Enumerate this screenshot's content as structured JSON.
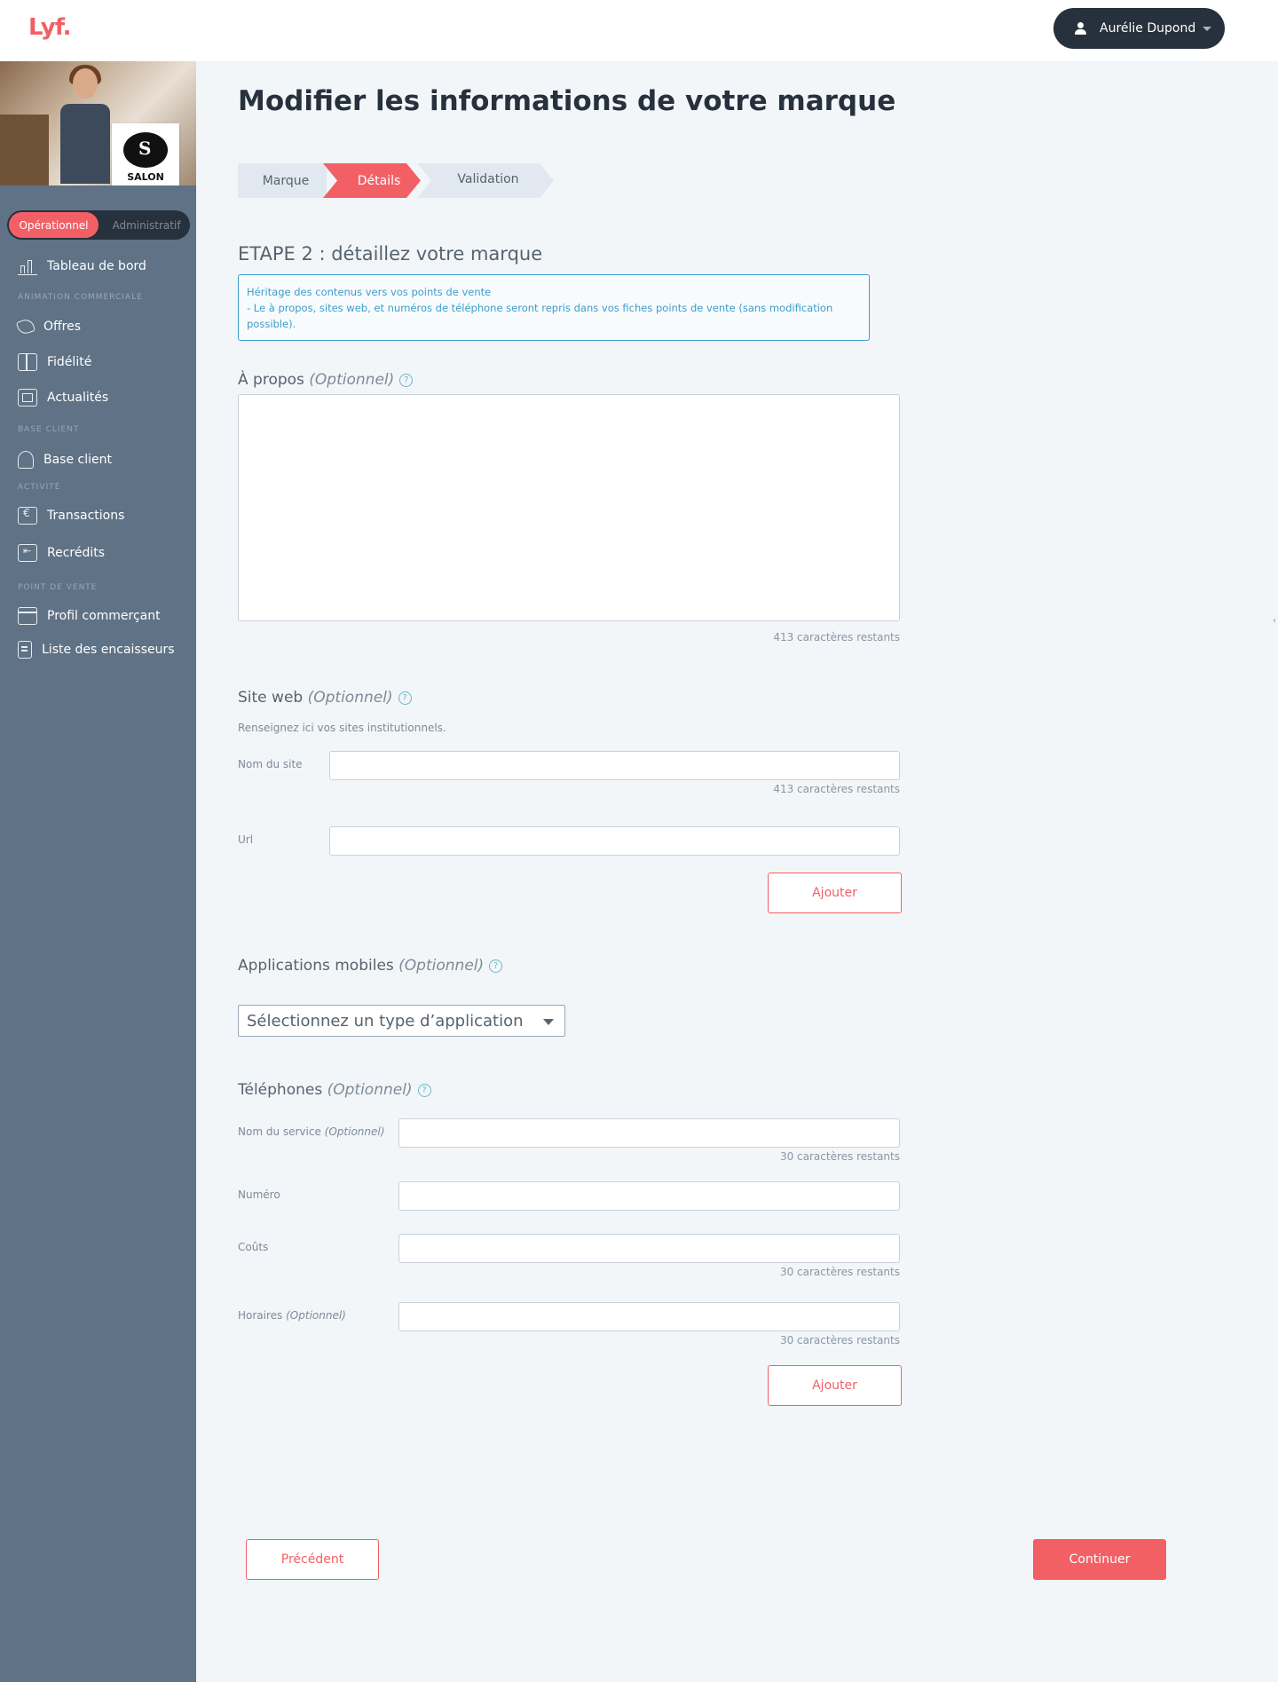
{
  "app": {
    "logo": "Lyf.",
    "user_name": "Aurélie Dupond"
  },
  "sidebar": {
    "brand_logo_text": "SALON",
    "toggle": {
      "active": "Opérationnel",
      "inactive": "Administratif"
    },
    "sections": {
      "animation": "ANIMATION COMMERCIALE",
      "base": "BASE CLIENT",
      "activite": "ACTIVITÉ",
      "point_vente": "POINT DE VENTE"
    },
    "items": {
      "tableau": "Tableau de bord",
      "offres": "Offres",
      "fidelite": "Fidélité",
      "actualites": "Actualités",
      "base_client": "Base client",
      "transactions": "Transactions",
      "recredits": "Recrédits",
      "profil": "Profil commerçant",
      "encaisseurs": "Liste des encaisseurs"
    }
  },
  "page": {
    "title": "Modifier les informations de votre marque",
    "steps": [
      "Marque",
      "Détails",
      "Validation"
    ],
    "step_heading": "ETAPE 2 : détaillez votre marque",
    "info_line1": "Héritage des contenus vers vos points de vente",
    "info_line2": "- Le à propos, sites web, et numéros de téléphone seront repris dans vos fiches points de vente (sans modification possible)."
  },
  "about": {
    "label": "À propos",
    "optional": "(Optionnel)",
    "counter": "413 caractères restants"
  },
  "website": {
    "label": "Site web",
    "optional": "(Optionnel)",
    "hint": "Renseignez ici vos sites institutionnels.",
    "name_label": "Nom du site",
    "name_counter": "413 caractères restants",
    "url_label": "Url",
    "add_button": "Ajouter"
  },
  "apps": {
    "label": "Applications mobiles",
    "optional": "(Optionnel)",
    "select_placeholder": "Sélectionnez un type d’application"
  },
  "phones": {
    "label": "Téléphones",
    "optional": "(Optionnel)",
    "service_label": "Nom du service",
    "service_optional": "(Optionnel)",
    "service_counter": "30 caractères restants",
    "number_label": "Numéro",
    "cost_label": "Coûts",
    "cost_counter": "30 caractères restants",
    "hours_label": "Horaires",
    "hours_optional": "(Optionnel)",
    "hours_counter": "30 caractères restants",
    "add_button": "Ajouter"
  },
  "footer": {
    "prev_button": "Précédent",
    "next_button": "Continuer"
  },
  "colors": {
    "accent": "#f26066",
    "sidebar": "#5f7286",
    "dark": "#27313d",
    "info": "#3a9fc8"
  }
}
